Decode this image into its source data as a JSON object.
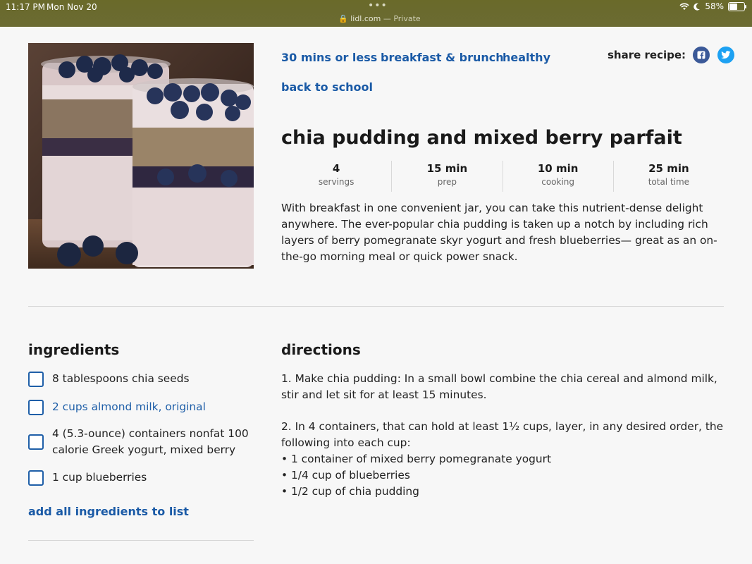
{
  "status": {
    "time": "11:17 PM",
    "date": "Mon Nov 20",
    "battery": "58%",
    "battery_level": 0.58,
    "url": "lidl.com",
    "private_label": "— Private"
  },
  "tags": [
    "30 mins or less",
    "breakfast & brunch",
    "healthy",
    "back to school"
  ],
  "share": {
    "label": "share recipe:",
    "facebook": "f",
    "twitter": "t"
  },
  "recipe": {
    "title": "chia pudding and mixed berry parfait",
    "stats": [
      {
        "value": "4",
        "label": "servings"
      },
      {
        "value": "15 min",
        "label": "prep"
      },
      {
        "value": "10 min",
        "label": "cooking"
      },
      {
        "value": "25 min",
        "label": "total time"
      }
    ],
    "description": "With breakfast in one convenient jar, you can take this nutrient-dense delight anywhere. The ever-popular chia pudding is taken up a notch by including rich layers of berry pomegranate skyr yogurt and fresh blueberries— great as an on-the-go morning meal or quick power snack."
  },
  "ingredients": {
    "heading": "ingredients",
    "items": [
      "8 tablespoons chia seeds",
      "2 cups almond milk, original",
      "4 (5.3-ounce) containers nonfat 100 calorie Greek yogurt, mixed berry",
      "1 cup blueberries"
    ],
    "add_all": "add all ingredients to list"
  },
  "directions": {
    "heading": "directions",
    "step1": "1. Make chia pudding: In a small bowl combine the chia cereal and almond milk, stir and let sit for at least 15 minutes.",
    "step2": "2. In 4 containers, that can hold at least 1½ cups, layer, in any desired order, the following into each cup:",
    "bullets": [
      "• 1 container of mixed berry pomegranate yogurt",
      "• 1/4 cup of blueberries",
      "• 1/2 cup of chia pudding"
    ]
  }
}
